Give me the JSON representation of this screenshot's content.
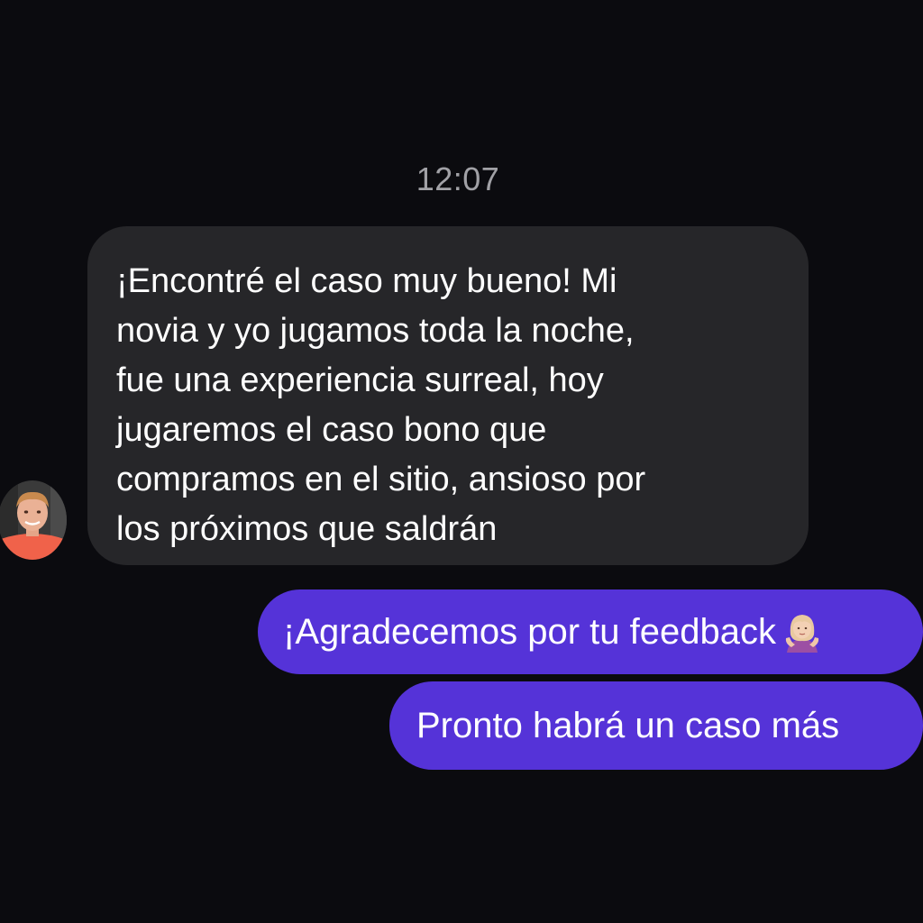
{
  "chat": {
    "timestamp": "12:07",
    "incoming": {
      "lines": [
        "¡Encontré el caso muy bueno! Mi",
        "novia y yo jugamos toda la noche,",
        "fue una experiencia surreal, hoy",
        "jugaremos el caso bono que",
        "compramos en el sitio, ansioso por",
        "los próximos que saldrán"
      ],
      "avatar_icon": "user-avatar"
    },
    "outgoing": [
      {
        "text": "¡Agradecemos por tu feedback",
        "emoji_icon": "woman-shrugging-emoji"
      },
      {
        "text": "Pronto habrá un caso más"
      }
    ]
  },
  "colors": {
    "background": "#0b0b0f",
    "incoming_bubble": "#262629",
    "outgoing_bubble": "#5533d8",
    "timestamp_text": "#a1a1a6"
  }
}
